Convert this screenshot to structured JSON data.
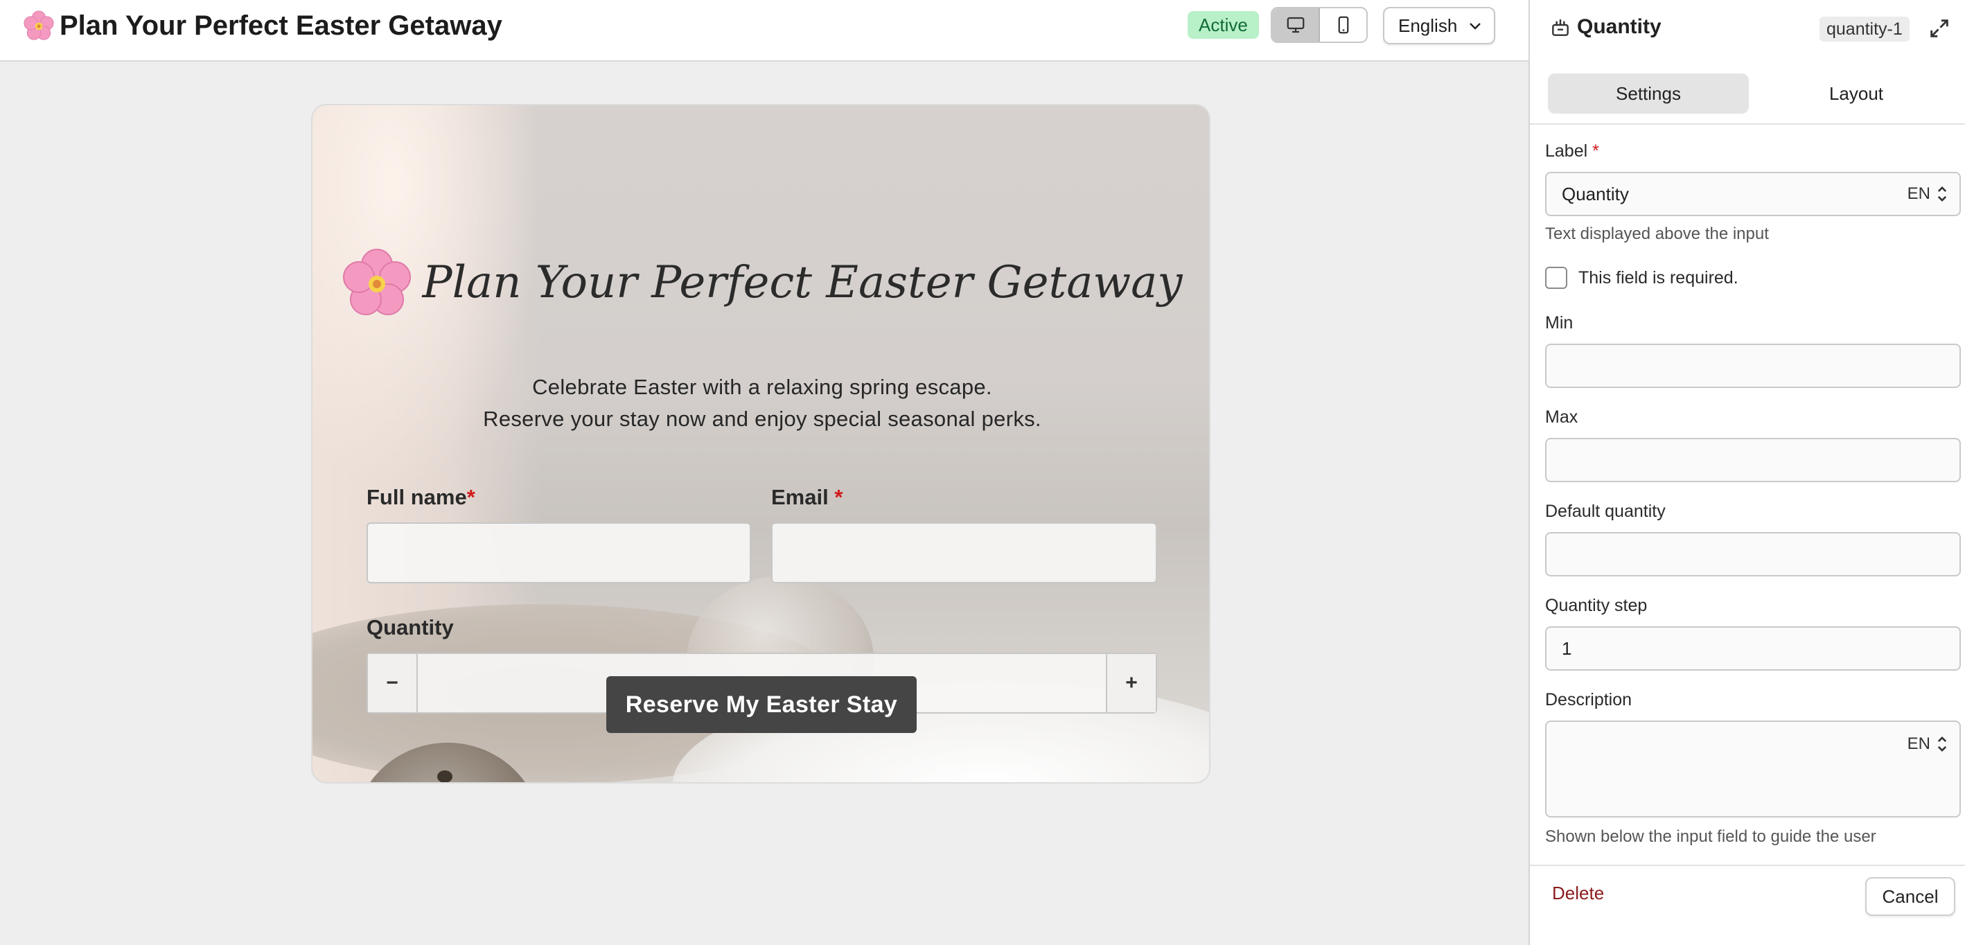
{
  "header": {
    "title": "Plan Your Perfect Easter Getaway",
    "status": "Active",
    "language": "English"
  },
  "form": {
    "title": "Plan Your Perfect Easter Getaway",
    "subtitle_line1": "Celebrate Easter with a relaxing spring escape.",
    "subtitle_line2": "Reserve your stay now and enjoy special seasonal perks.",
    "fields": {
      "full_name_label": "Full name",
      "email_label": "Email",
      "required_mark": "*",
      "quantity_label": "Quantity",
      "minus": "−",
      "plus": "+"
    },
    "submit_label": "Reserve My Easter Stay"
  },
  "panel": {
    "title": "Quantity",
    "field_id": "quantity-1",
    "tabs": [
      "Settings",
      "Layout"
    ],
    "label_label": "Label",
    "required_mark": "*",
    "label_value": "Quantity",
    "lang_code": "EN",
    "label_help": "Text displayed above the input",
    "required_checkbox": "This field is required.",
    "required_checked": false,
    "min_label": "Min",
    "min_value": "",
    "max_label": "Max",
    "max_value": "",
    "default_label": "Default quantity",
    "default_value": "",
    "step_label": "Quantity step",
    "step_value": "1",
    "description_label": "Description",
    "description_help": "Shown below the input field to guide the user",
    "delete_label": "Delete",
    "cancel_label": "Cancel"
  },
  "icons": {
    "flower": "cherry-blossom-icon",
    "desktop": "desktop-icon",
    "mobile": "mobile-icon",
    "chevron": "chevron-down-icon",
    "quantity": "quantity-field-icon",
    "expand": "expand-icon",
    "updown": "chevron-updown-icon"
  },
  "colors": {
    "active_badge_bg": "#b8f0c8",
    "active_badge_text": "#126b34",
    "required": "#d11a1a",
    "submit_bg": "#454545",
    "delete_text": "#8c1b1b"
  }
}
